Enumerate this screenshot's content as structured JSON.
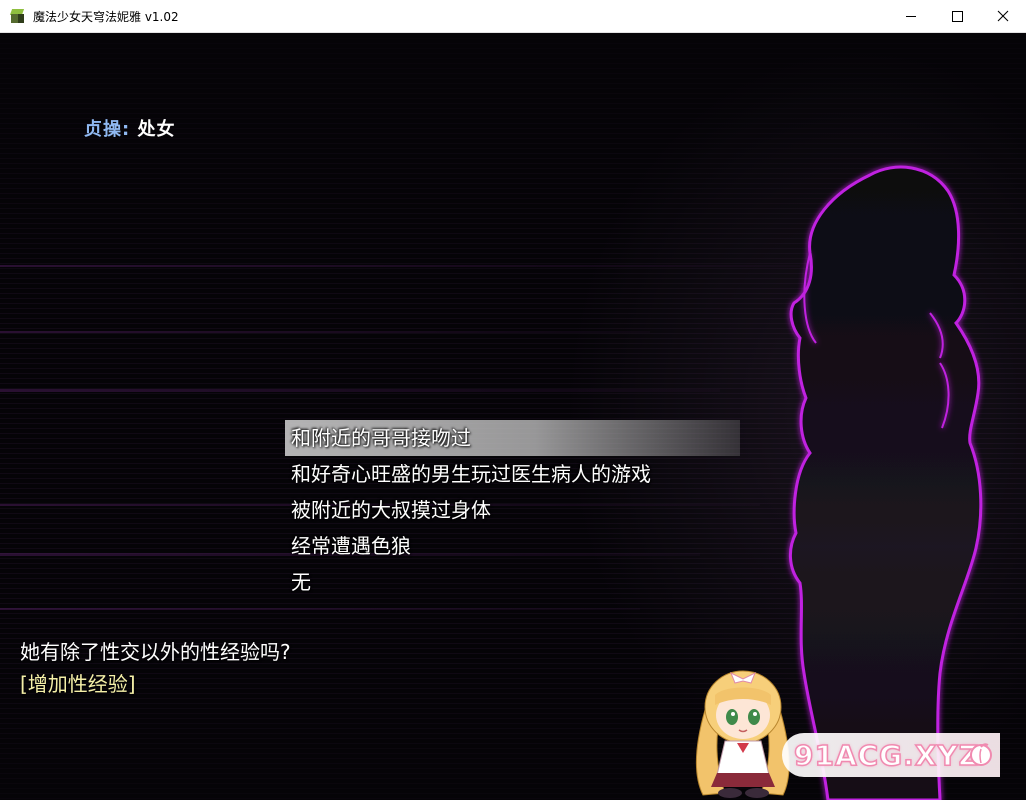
{
  "window": {
    "title": "魔法少女天穹法妮雅 v1.02",
    "controls": {
      "minimize": "minimize-icon",
      "maximize": "maximize-icon",
      "close": "close-icon"
    }
  },
  "status": {
    "label": "贞操:",
    "value": "处女"
  },
  "choices": [
    {
      "label": "和附近的哥哥接吻过",
      "selected": true
    },
    {
      "label": "和好奇心旺盛的男生玩过医生病人的游戏",
      "selected": false
    },
    {
      "label": "被附近的大叔摸过身体",
      "selected": false
    },
    {
      "label": "经常遭遇色狼",
      "selected": false
    },
    {
      "label": "无",
      "selected": false
    }
  ],
  "message": {
    "question": "她有除了性交以外的性经验吗?",
    "tag": "[增加性经验]"
  },
  "watermark": {
    "text": "91ACG.XYZ",
    "icon": "peach-icon"
  },
  "colors": {
    "silhouette_outline": "#c020e0",
    "status_label": "#8fb8f0",
    "tag_text": "#f5f0a8",
    "watermark_stroke": "#f08ab0"
  }
}
